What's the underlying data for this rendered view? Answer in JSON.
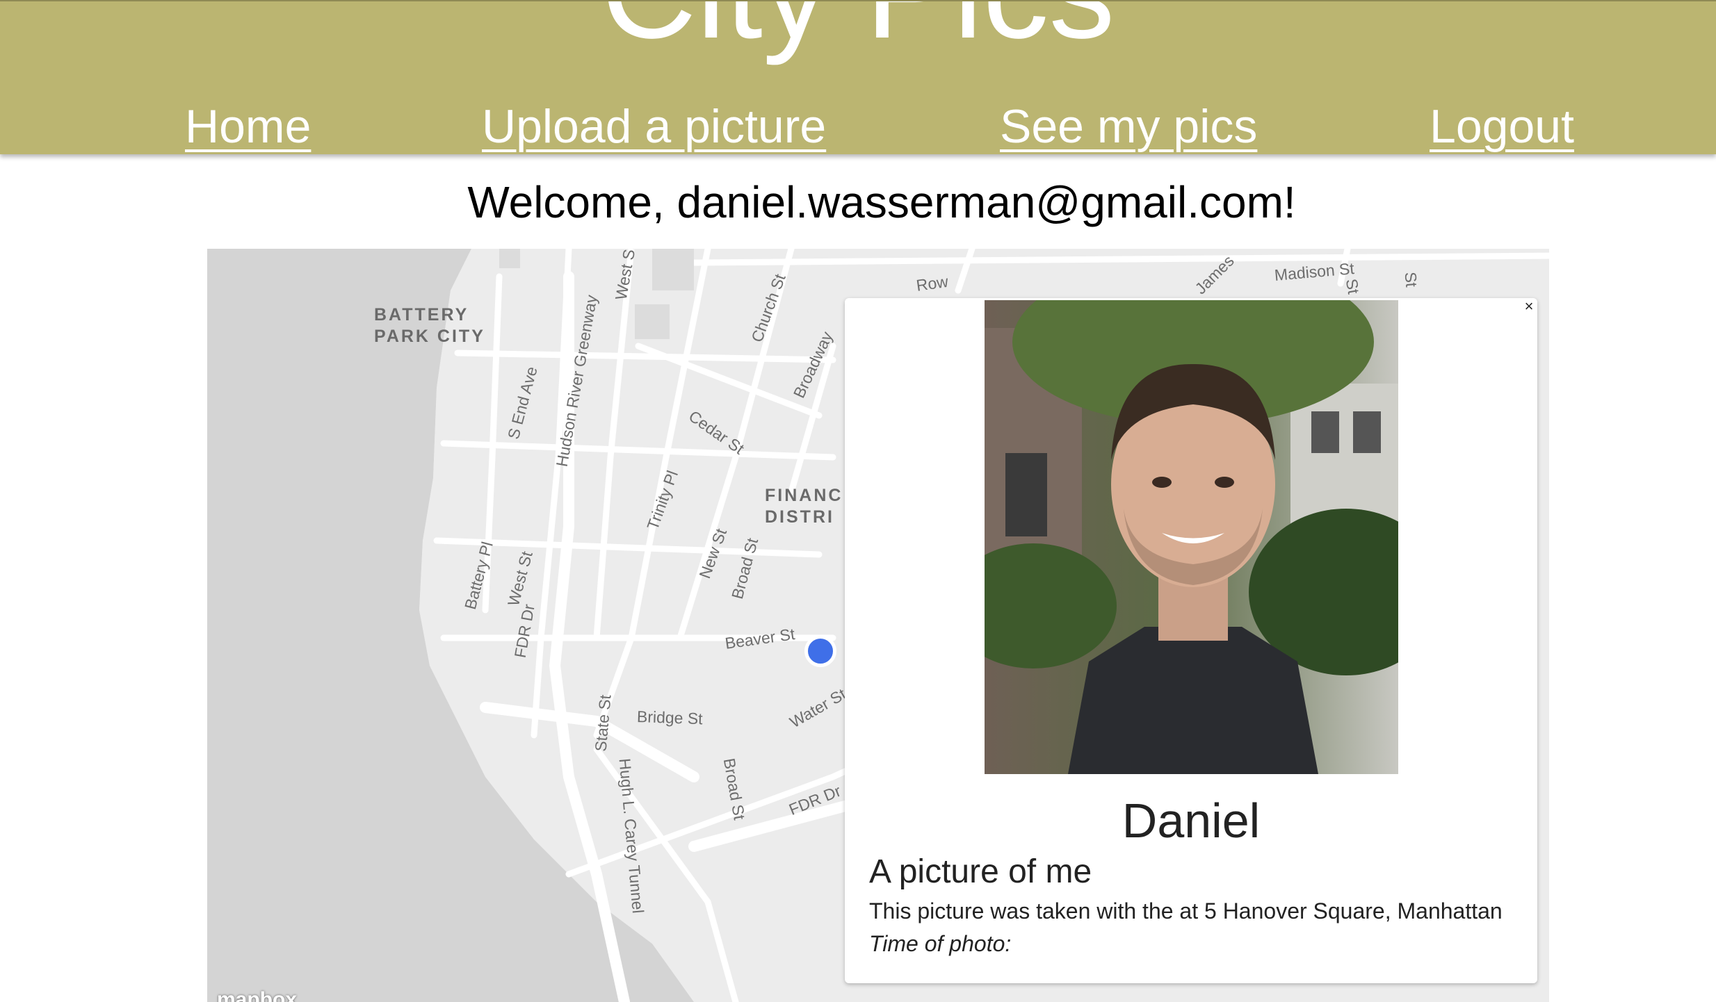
{
  "header": {
    "title": "City Pics",
    "nav": [
      {
        "label": "Home"
      },
      {
        "label": "Upload a picture"
      },
      {
        "label": "See my pics"
      },
      {
        "label": "Logout"
      }
    ]
  },
  "welcome": "Welcome, daniel.wasserman@gmail.com!",
  "map": {
    "districts": [
      "BATTERY\nPARK CITY",
      "FINANC\nDISTRI"
    ],
    "streets": [
      "West St",
      "Church St",
      "Broadway",
      "Cedar St",
      "S End Ave",
      "Hudson River Greenway",
      "Trinity Pl",
      "New St",
      "Broad St",
      "Beaver St",
      "Battery Pl",
      "West St",
      "FDR Dr",
      "Bridge St",
      "State St",
      "Broad St",
      "Water St",
      "FDR Dr",
      "Hugh L. Carey Tunnel",
      "Madison St",
      "James",
      "Row",
      "St",
      "St"
    ],
    "attribution": "mapbox"
  },
  "popup": {
    "close": "×",
    "name": "Daniel",
    "caption": "A picture of me",
    "description": "This picture was taken with the at 5 Hanover Square, Manhattan",
    "time_label": "Time of photo:"
  },
  "colors": {
    "header_bg": "#bbb571",
    "marker": "#3f6fe8"
  }
}
